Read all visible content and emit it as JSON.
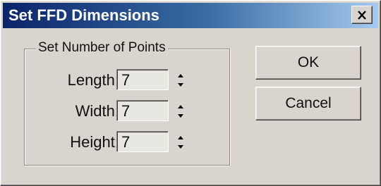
{
  "window": {
    "title": "Set FFD Dimensions",
    "close_icon": "close-icon"
  },
  "group": {
    "legend": "Set Number of Points",
    "fields": [
      {
        "label": "Length:",
        "value": "7"
      },
      {
        "label": "Width:",
        "value": "7"
      },
      {
        "label": "Height:",
        "value": "7"
      }
    ]
  },
  "buttons": {
    "ok_label": "OK",
    "cancel_label": "Cancel"
  },
  "colors": {
    "titlebar_start": "#0a246a",
    "titlebar_end": "#a6caf0",
    "face": "#d9d5ce"
  }
}
